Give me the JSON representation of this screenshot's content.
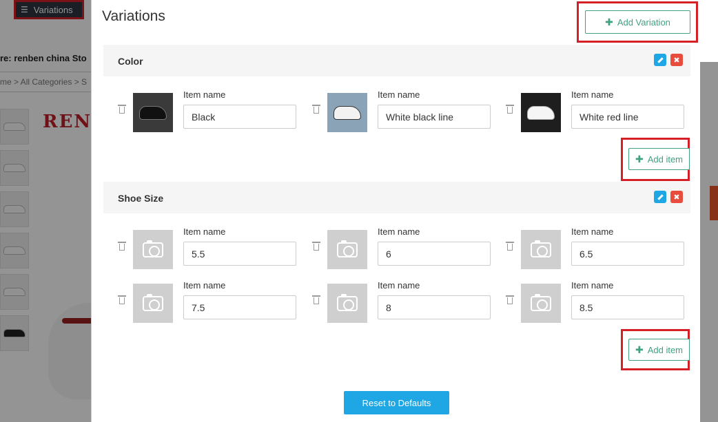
{
  "background": {
    "variations_tab": "Variations",
    "store_label": "re:  renben china Sto",
    "breadcrumb": "me > All Categories > S",
    "brand": "REN"
  },
  "modal": {
    "title": "Variations",
    "add_variation": "Add Variation",
    "reset": "Reset to Defaults",
    "add_item": "Add item",
    "item_label": "Item name"
  },
  "sections": [
    {
      "title": "Color",
      "items": [
        {
          "value": "Black"
        },
        {
          "value": "White black line"
        },
        {
          "value": "White red line"
        }
      ]
    },
    {
      "title": "Shoe Size",
      "items": [
        {
          "value": "5.5"
        },
        {
          "value": "6"
        },
        {
          "value": "6.5"
        },
        {
          "value": "7.5"
        },
        {
          "value": "8"
        },
        {
          "value": "8.5"
        }
      ]
    }
  ]
}
